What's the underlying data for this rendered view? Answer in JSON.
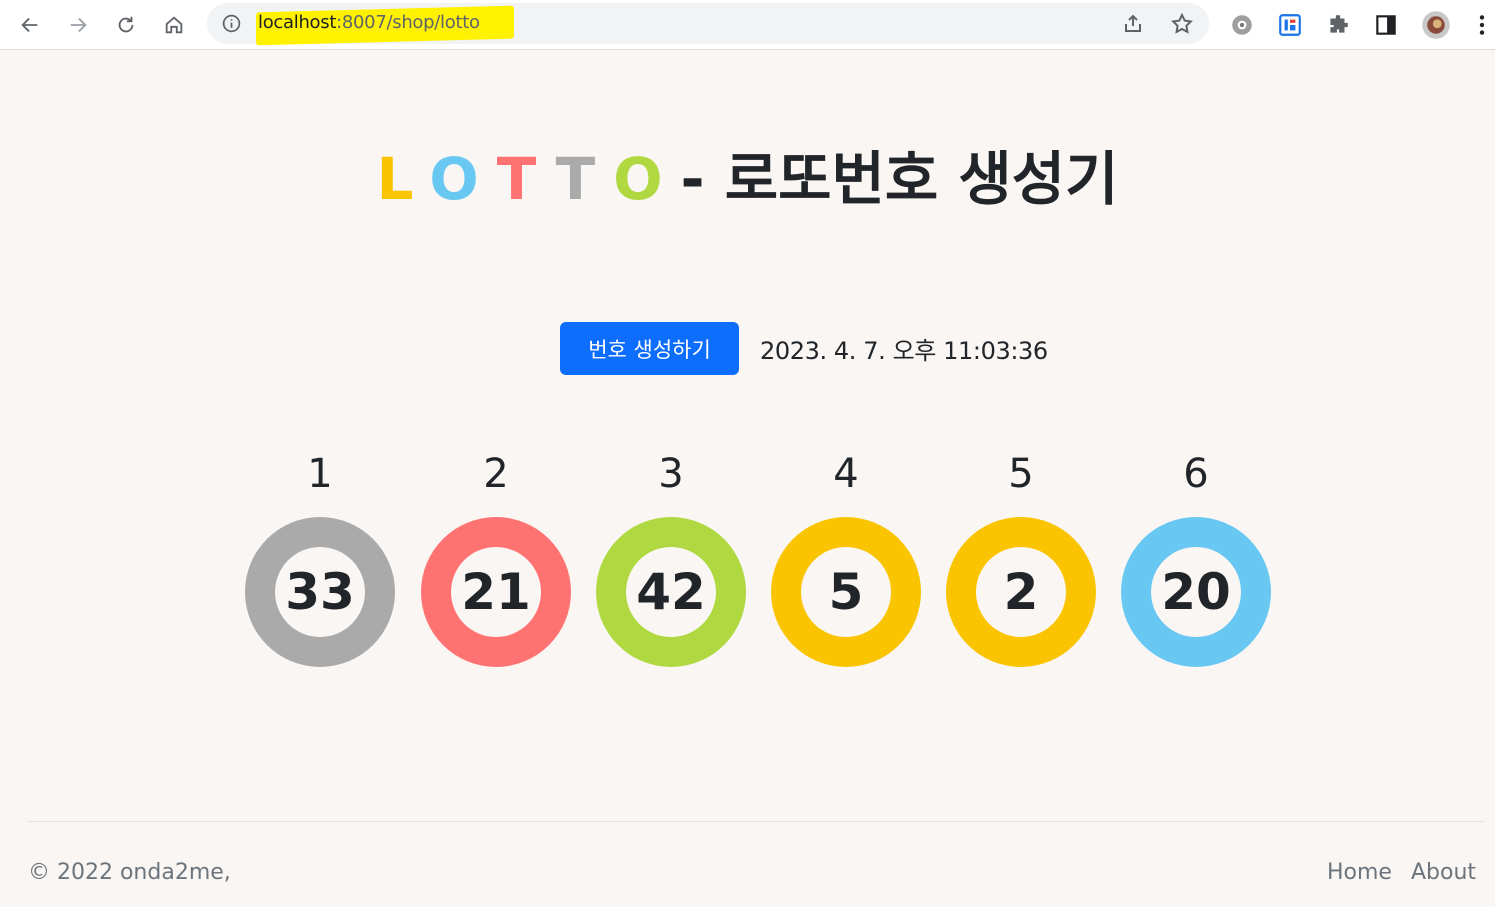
{
  "browser": {
    "url_host": "localhost",
    "url_rest": ":8007/shop/lotto"
  },
  "title": {
    "letters": [
      {
        "char": "L",
        "color": "#fbc400"
      },
      {
        "char": "O",
        "color": "#69c8f2"
      },
      {
        "char": "T",
        "color": "#ff7272"
      },
      {
        "char": "T",
        "color": "#aaaaaa"
      },
      {
        "char": "O",
        "color": "#b0d840"
      }
    ],
    "suffix": "- 로또번호 생성기"
  },
  "generate_button_label": "번호 생성하기",
  "timestamp": "2023. 4. 7. 오후 11:03:36",
  "balls": [
    {
      "index": "1",
      "number": "33",
      "color": "#aaaaaa"
    },
    {
      "index": "2",
      "number": "21",
      "color": "#ff7272"
    },
    {
      "index": "3",
      "number": "42",
      "color": "#b0d840"
    },
    {
      "index": "4",
      "number": "5",
      "color": "#fbc400"
    },
    {
      "index": "5",
      "number": "2",
      "color": "#fbc400"
    },
    {
      "index": "6",
      "number": "20",
      "color": "#69c8f2"
    }
  ],
  "footer": {
    "copyright": "© 2022 onda2me,",
    "links": [
      "Home",
      "About"
    ]
  }
}
